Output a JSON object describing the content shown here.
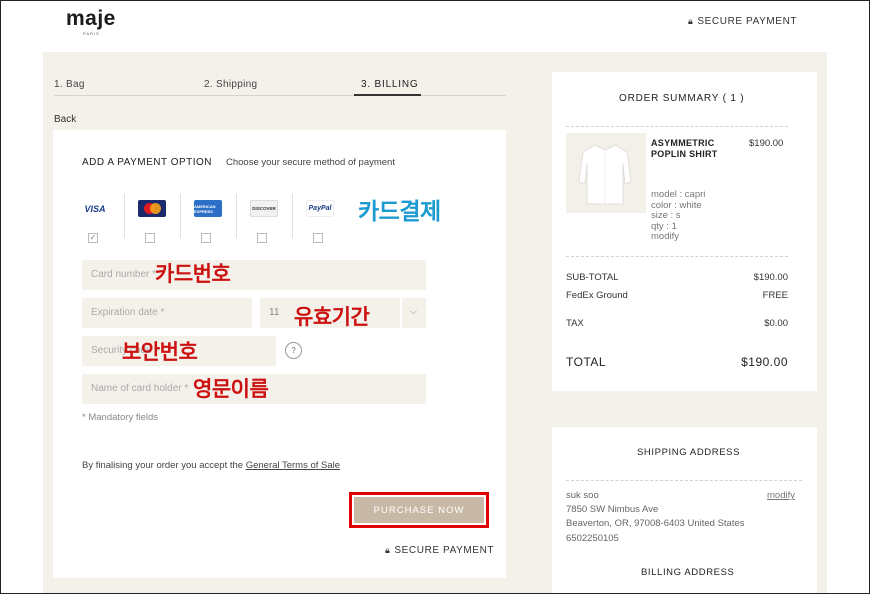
{
  "header": {
    "logo": "maje",
    "logo_sub": "PARIS",
    "secure_payment": "SECURE PAYMENT"
  },
  "steps": [
    {
      "label": "1. Bag"
    },
    {
      "label": "2. Shipping"
    },
    {
      "label": "3. BILLING"
    }
  ],
  "back": "Back",
  "payment": {
    "title": "ADD A PAYMENT OPTION",
    "subtitle": "Choose your secure method of payment",
    "methods": [
      {
        "name": "VISA",
        "icon": "visa-icon",
        "checked": true
      },
      {
        "name": "MasterCard",
        "icon": "mastercard-icon",
        "checked": false
      },
      {
        "name": "AMERICAN EXPRESS",
        "icon": "amex-icon",
        "checked": false
      },
      {
        "name": "DISCOVER",
        "icon": "discover-icon",
        "checked": false
      },
      {
        "name": "PayPal",
        "icon": "paypal-icon",
        "checked": false
      }
    ],
    "card_number_placeholder": "Card number *",
    "expiration_placeholder": "Expiration date *",
    "expiration_month": "11",
    "security_placeholder": "Security code *",
    "help": "?",
    "name_placeholder": "Name of card holder *",
    "mandatory": "* Mandatory fields",
    "terms_prefix": "By finalising your order you accept the ",
    "terms_link": "General Terms of Sale",
    "purchase_button": "PURCHASE NOW",
    "secure_payment": "SECURE PAYMENT",
    "highlight_color": "#e00000"
  },
  "annotations": {
    "card_payment": "카드결제",
    "card_number": "카드번호",
    "expiration": "유효기간",
    "security": "보안번호",
    "english_name": "영문이름"
  },
  "summary": {
    "title": "ORDER SUMMARY ( 1 )",
    "product": {
      "name": "ASYMMETRIC POPLIN SHIRT",
      "price": "$190.00",
      "model": "model : capri",
      "color": "color : white",
      "size": "size : s",
      "qty": "qty : 1",
      "modify": "modify"
    },
    "subtotal_label": "SUB-TOTAL",
    "subtotal_value": "$190.00",
    "shipping_label": "FedEx Ground",
    "shipping_value": "FREE",
    "tax_label": "TAX",
    "tax_value": "$0.00",
    "total_label": "TOTAL",
    "total_value": "$190.00"
  },
  "shipping_address": {
    "title": "SHIPPING ADDRESS",
    "name": "suk soo",
    "modify": "modify",
    "street": "7850 SW Nimbus Ave",
    "city": "Beaverton, OR, 97008-6403 United States",
    "phone": "6502250105"
  },
  "billing_address": {
    "title": "BILLING ADDRESS"
  }
}
